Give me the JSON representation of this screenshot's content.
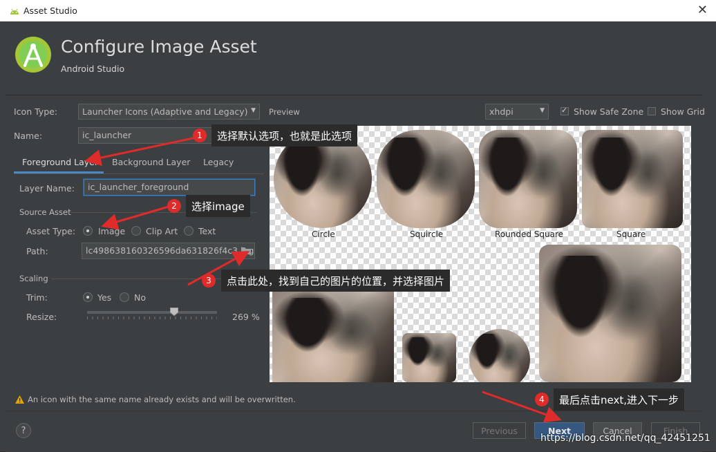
{
  "window": {
    "title": "Asset Studio",
    "close_symbol": "✕"
  },
  "header": {
    "title": "Configure Image Asset",
    "subtitle": "Android Studio"
  },
  "form": {
    "icon_type_label": "Icon Type:",
    "icon_type_value": "Launcher Icons (Adaptive and Legacy)",
    "name_label": "Name:",
    "name_value": "ic_launcher",
    "tabs": [
      "Foreground Layer",
      "Background Layer",
      "Legacy"
    ],
    "layer_name_label": "Layer Name:",
    "layer_name_value": "ic_launcher_foreground",
    "source_asset_label": "Source Asset",
    "asset_type_label": "Asset Type:",
    "asset_types": [
      "Image",
      "Clip Art",
      "Text"
    ],
    "path_label": "Path:",
    "path_value": "lc498638160326596da631826f4c3.jpg",
    "scaling_label": "Scaling",
    "trim_label": "Trim:",
    "trim_options": [
      "Yes",
      "No"
    ],
    "resize_label": "Resize:",
    "resize_value": "269 %",
    "resize_level": 0.67
  },
  "preview": {
    "label": "Preview",
    "density": "xhdpi",
    "show_safe_zone": "Show Safe Zone",
    "show_grid": "Show Grid",
    "shapes": [
      "Circle",
      "Squircle",
      "Rounded Square",
      "Square"
    ]
  },
  "warning": "An icon with the same name already exists and will be overwritten.",
  "buttons": {
    "help": "?",
    "previous": "Previous",
    "next": "Next",
    "cancel": "Cancel",
    "finish": "Finish"
  },
  "annotations": [
    {
      "num": "1",
      "text": "选择默认选项，也就是此选项"
    },
    {
      "num": "2",
      "text": "选择image"
    },
    {
      "num": "3",
      "text": "点击此处，找到自己的图片的位置，并选择图片"
    },
    {
      "num": "4",
      "text": "最后点击next,进入下一步"
    }
  ],
  "watermark": "https://blog.csdn.net/qq_42451251",
  "colors": {
    "accent": "#365880",
    "annotation_red": "#e02b2b",
    "logo_green": "#a4c639"
  }
}
